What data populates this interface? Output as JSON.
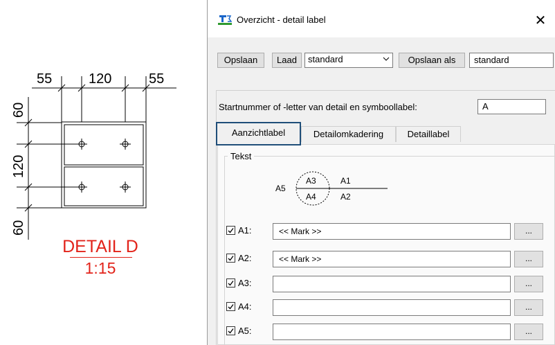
{
  "drawing": {
    "dims_horizontal": [
      "55",
      "120",
      "55"
    ],
    "dims_vertical": [
      "60",
      "120",
      "60"
    ],
    "detail_title": "DETAIL D",
    "detail_scale": "1:15",
    "accent_color": "#e2231a"
  },
  "dialog": {
    "title": "Overzicht - detail label",
    "close_symbol": "✕",
    "toolbar": {
      "save_label": "Opslaan",
      "load_label": "Laad",
      "preset_value": "standard",
      "save_as_label": "Opslaan als",
      "save_as_value": "standard"
    },
    "start_label": "Startnummer of -letter van detail en symboollabel:",
    "start_value": "A",
    "tabs": [
      {
        "label": "Aanzichtlabel",
        "active": true
      },
      {
        "label": "Detailomkadering",
        "active": false
      },
      {
        "label": "Detaillabel",
        "active": false
      }
    ],
    "group_title": "Tekst",
    "symbol": {
      "left": "A5",
      "top": "A3",
      "bottom": "A4",
      "right_top": "A1",
      "right_bottom": "A2"
    },
    "rows": [
      {
        "label": "A1:",
        "checked": true,
        "value": "<< Mark >>",
        "button": "..."
      },
      {
        "label": "A2:",
        "checked": true,
        "value": "<< Mark >>",
        "button": "..."
      },
      {
        "label": "A3:",
        "checked": true,
        "value": "",
        "button": "..."
      },
      {
        "label": "A4:",
        "checked": true,
        "value": "",
        "button": "..."
      },
      {
        "label": "A5:",
        "checked": true,
        "value": "",
        "button": "..."
      }
    ],
    "colors": {
      "tab_highlight": "#1f4e79",
      "icon_blue": "#1a66c9",
      "icon_green": "#2f9a2f"
    }
  }
}
